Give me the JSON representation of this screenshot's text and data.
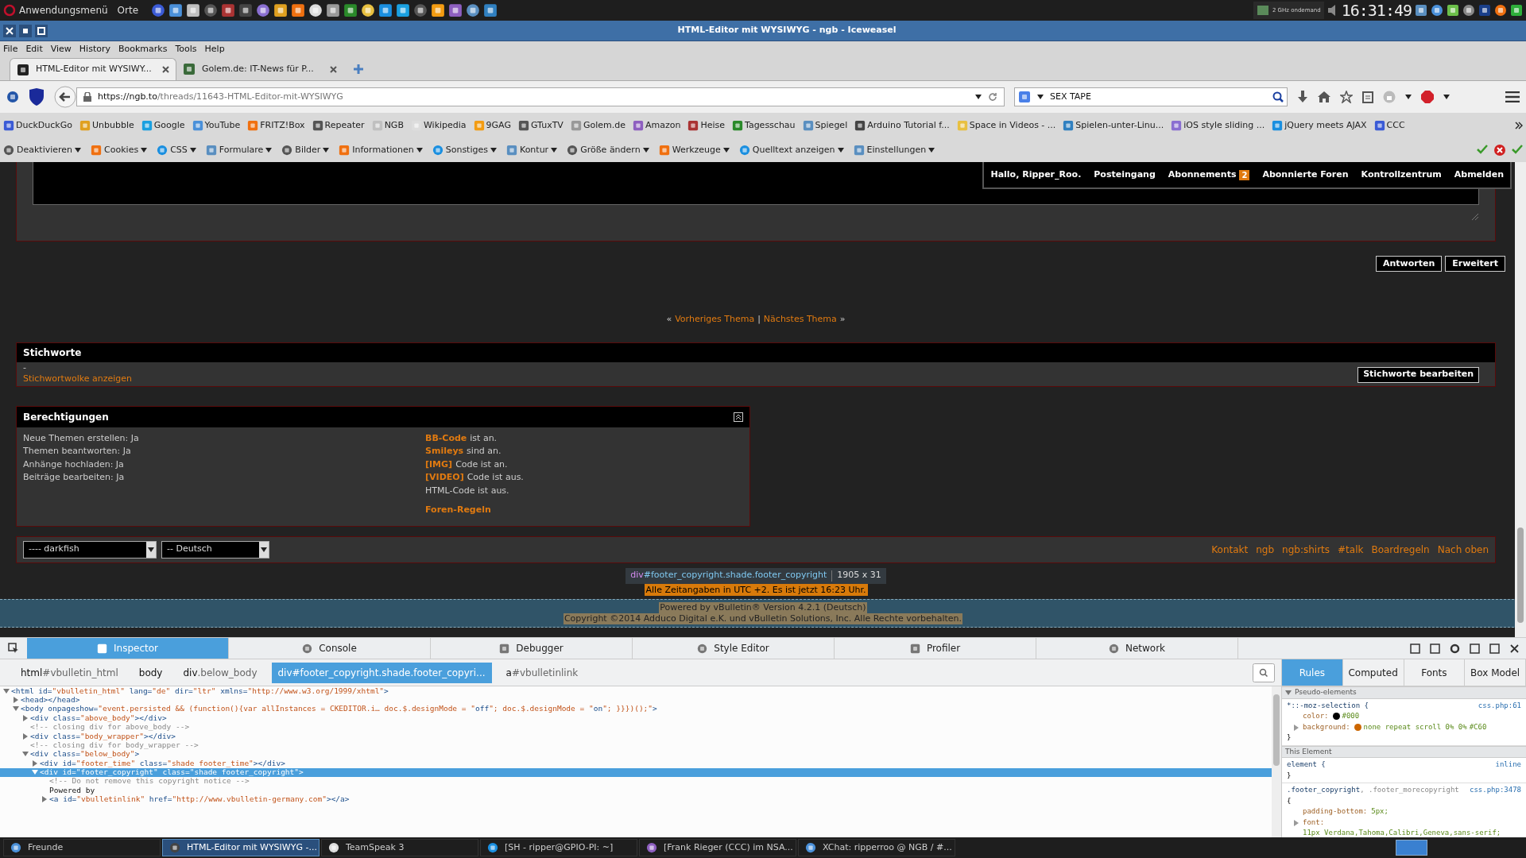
{
  "top_panel": {
    "menu": "Anwendungsmenü",
    "places": "Orte",
    "cpu": "2 GHz ondemand",
    "clock": "16:31:49"
  },
  "window": {
    "title": "HTML-Editor mit WYSIWYG - ngb - Iceweasel"
  },
  "menu": [
    "File",
    "Edit",
    "View",
    "History",
    "Bookmarks",
    "Tools",
    "Help"
  ],
  "tabs": [
    {
      "label": "HTML-Editor mit WYSIWY...",
      "selected": true
    },
    {
      "label": "Golem.de: IT-News für P...",
      "selected": false
    }
  ],
  "address": {
    "url_host": "https://ngb.to",
    "url_path": "/threads/11643-HTML-Editor-mit-WYSIWYG"
  },
  "search": {
    "value": "SEX TAPE"
  },
  "bookmarks": [
    "DuckDuckGo",
    "Unbubble",
    "Google",
    "YouTube",
    "FRITZ!Box",
    "Repeater",
    "NGB",
    "Wikipedia",
    "9GAG",
    "GTuxTV",
    "Golem.de",
    "Amazon",
    "Heise",
    "Tagesschau",
    "Spiegel",
    "Arduino Tutorial f...",
    "Space in Videos - ...",
    "Spielen-unter-Linu...",
    "iOS style sliding ...",
    "jQuery meets AJAX",
    "CCC"
  ],
  "webdev_toolbar": [
    "Deaktivieren",
    "Cookies",
    "CSS",
    "Formulare",
    "Bilder",
    "Informationen",
    "Sonstiges",
    "Kontur",
    "Größe ändern",
    "Werkzeuge",
    "Quelltext anzeigen",
    "Einstellungen"
  ],
  "page": {
    "user_nav": {
      "greeting": "Hallo, Ripper_Roo.",
      "items": [
        {
          "label": "Posteingang"
        },
        {
          "label": "Abonnements",
          "badge": "2"
        },
        {
          "label": "Abonnierte Foren"
        },
        {
          "label": "Kontrollzentrum"
        },
        {
          "label": "Abmelden"
        }
      ]
    },
    "reply_buttons": [
      "Antworten",
      "Erweitert"
    ],
    "thread_nav": {
      "open": "«",
      "previous": "Vorheriges Thema",
      "separator": "|",
      "next": "Nächstes Thema",
      "close": "»"
    },
    "tags": {
      "title": "Stichworte",
      "value": "-",
      "link": "Stichwortwolke anzeigen",
      "button": "Stichworte bearbeiten"
    },
    "permissions": {
      "title": "Berechtigungen",
      "left": [
        "Neue Themen erstellen: Ja",
        "Themen beantworten: Ja",
        "Anhänge hochladen: Ja",
        "Beiträge bearbeiten: Ja"
      ],
      "right": [
        {
          "link": "BB-Code",
          "text": "ist an."
        },
        {
          "link": "Smileys",
          "text": "sind an."
        },
        {
          "link": "[IMG]",
          "text": "Code ist an."
        },
        {
          "link": "[VIDEO]",
          "text": "Code ist aus."
        },
        {
          "text": "HTML-Code ist aus."
        }
      ],
      "rules_link": "Foren-Regeln"
    },
    "footer": {
      "style_select": "---- darkfish",
      "language_select": "-- Deutsch",
      "links": [
        "Kontakt",
        "ngb",
        "ngb:shirts",
        "#talk",
        "Boardregeln",
        "Nach oben"
      ]
    },
    "highlight_tooltip": {
      "tag": "div",
      "selector": "#footer_copyright.shade.footer_copyright",
      "size": "1905 x 31"
    },
    "footer_time": "Alle Zeitangaben in UTC +2. Es ist jetzt 16:23 Uhr.",
    "copyright": [
      "Powered by vBulletin® Version 4.2.1 (Deutsch)",
      "Copyright ©2014 Adduco Digital e.K. und vBulletin Solutions, Inc. Alle Rechte vorbehalten."
    ]
  },
  "devtools": {
    "tabs": [
      {
        "label": "Inspector",
        "selected": true
      },
      {
        "label": "Console",
        "selected": false
      },
      {
        "label": "Debugger",
        "selected": false
      },
      {
        "label": "Style Editor",
        "selected": false
      },
      {
        "label": "Profiler",
        "selected": false
      },
      {
        "label": "Network",
        "selected": false
      }
    ],
    "breadcrumbs": [
      {
        "tag": "html",
        "rest": "#vbulletin_html",
        "selected": false
      },
      {
        "tag": "body",
        "selected": false
      },
      {
        "tag": "div",
        "rest": ".below_body",
        "selected": false
      },
      {
        "tag": "div",
        "rest": "#footer_copyright.shade.footer_copyri...",
        "selected": true
      },
      {
        "tag": "a",
        "rest": "#vbulletinlink",
        "selected": false
      }
    ],
    "markup": [
      {
        "kind": "element",
        "text": "<html id=\"vbulletin_html\" lang=\"de\" dir=\"ltr\" xmlns=\"http://www.w3.org/1999/xhtml\">",
        "expanded": true,
        "selected": false,
        "children": [
          {
            "kind": "element",
            "text": "<head></head>",
            "expanded": false,
            "selected": false
          },
          {
            "kind": "element",
            "text": "<body onpageshow=\"event.persisted && (function(){var allInstances = CKEDITOR.i… doc.$.designMode = \"off\"; doc.$.designMode = \"on\"; }}})();\">",
            "expanded": true,
            "selected": false,
            "children": [
              {
                "kind": "element",
                "text": "<div class=\"above_body\"></div>",
                "expanded": false,
                "selected": false
              },
              {
                "kind": "comment",
                "text": "<!-- closing div for above_body -->",
                "selected": false
              },
              {
                "kind": "element",
                "text": "<div class=\"body_wrapper\"></div>",
                "expanded": false,
                "selected": false
              },
              {
                "kind": "comment",
                "text": "<!-- closing div for body_wrapper -->",
                "selected": false
              },
              {
                "kind": "element",
                "text": "<div class=\"below_body\">",
                "expanded": true,
                "selected": false,
                "children": [
                  {
                    "kind": "element",
                    "text": "<div id=\"footer_time\" class=\"shade footer_time\"></div>",
                    "expanded": false,
                    "selected": false
                  },
                  {
                    "kind": "element",
                    "text": "<div id=\"footer_copyright\" class=\"shade footer_copyright\">",
                    "expanded": true,
                    "selected": true,
                    "children": [
                      {
                        "kind": "comment",
                        "text": "<!-- Do not remove this copyright notice -->",
                        "selected": false
                      },
                      {
                        "kind": "text",
                        "text": "Powered by",
                        "selected": false
                      },
                      {
                        "kind": "element",
                        "text": "<a id=\"vbulletinlink\" href=\"http://www.vbulletin-germany.com\"></a>",
                        "expanded": false,
                        "selected": false
                      }
                    ]
                  }
                ]
              }
            ]
          }
        ]
      }
    ],
    "side_tabs": [
      {
        "label": "Rules",
        "selected": true
      },
      {
        "label": "Computed",
        "selected": false
      },
      {
        "label": "Fonts",
        "selected": false
      },
      {
        "label": "Box Model",
        "selected": false
      }
    ],
    "rules": [
      {
        "kind": "header",
        "text": "Pseudo-elements",
        "expanded": true
      },
      {
        "kind": "rule",
        "selector": "*::-moz-selection {",
        "source": "css.php:61",
        "declarations": [
          {
            "prop": "color:",
            "value": "#000",
            "color": "#000000"
          },
          {
            "prop": "background:",
            "value": "none repeat scroll 0% 0%",
            "value_after": "#C60",
            "color": "#cc6600",
            "expandable": true
          }
        ],
        "close": "}"
      },
      {
        "kind": "header",
        "text": "This Element"
      },
      {
        "kind": "rule",
        "selector": "element {",
        "source": "inline",
        "close": "}"
      },
      {
        "kind": "rule",
        "selector": ".footer_copyright",
        "selector_more": ", .footer_morecopyright",
        "source": "css.php:3478",
        "open": "{",
        "declarations": [
          {
            "prop": "padding-bottom:",
            "value": "5px;"
          },
          {
            "prop": "font:",
            "value": "11px Verdana,Tahoma,Calibri,Geneva,sans-serif;",
            "expandable": true
          }
        ]
      }
    ]
  },
  "taskbar": [
    {
      "label": "Freunde",
      "selected": false
    },
    {
      "label": "HTML-Editor mit WYSIWYG -...",
      "selected": true
    },
    {
      "label": "TeamSpeak 3",
      "selected": false
    },
    {
      "label": "[SH - ripper@GPIO-PI: ~]",
      "selected": false
    },
    {
      "label": "[Frank Rieger (CCC) im NSA...",
      "selected": false
    },
    {
      "label": "XChat: ripperroo @ NGB / #...",
      "selected": false
    }
  ]
}
